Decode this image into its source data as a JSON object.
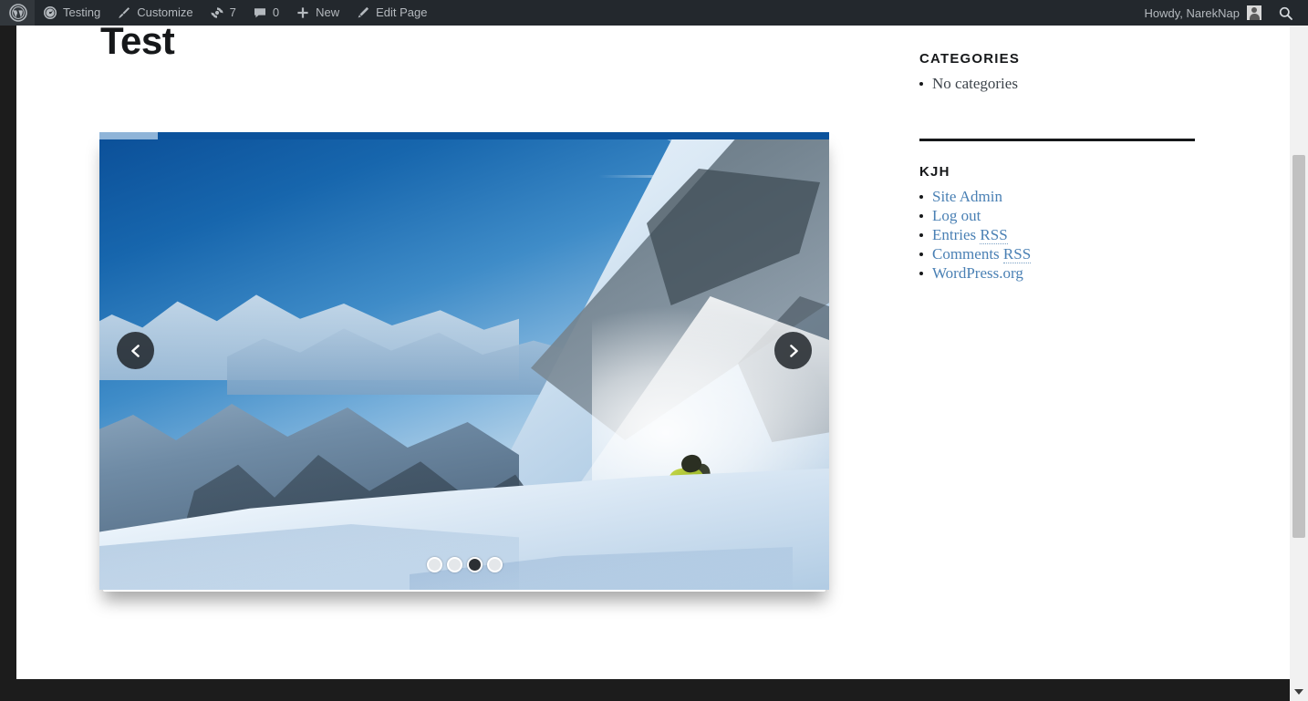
{
  "admin_bar": {
    "logo_icon": "wordpress-logo-icon",
    "items": [
      {
        "id": "site-name",
        "label": "Testing",
        "icon": "dashboard-speedometer-icon"
      },
      {
        "id": "customize",
        "label": "Customize",
        "icon": "paintbrush-icon"
      },
      {
        "id": "updates",
        "label": "7",
        "icon": "update-arrows-icon"
      },
      {
        "id": "comments",
        "label": "0",
        "icon": "comment-bubble-icon"
      },
      {
        "id": "new-content",
        "label": "New",
        "icon": "plus-icon"
      },
      {
        "id": "edit-page",
        "label": "Edit Page",
        "icon": "pencil-icon"
      }
    ],
    "howdy": "Howdy, NarekNap",
    "avatar_icon": "user-avatar-icon",
    "search_icon": "search-icon",
    "background_color": "#23282d",
    "text_color": "#b4b9be"
  },
  "page": {
    "title": "Test"
  },
  "slider": {
    "alt": "Skier carving through deep powder on a sunlit alpine slope",
    "progress_percent": 8,
    "prev_icon": "chevron-left-icon",
    "next_icon": "chevron-right-icon",
    "dots": [
      {
        "index": 1,
        "active": false
      },
      {
        "index": 2,
        "active": false
      },
      {
        "index": 3,
        "active": true
      },
      {
        "index": 4,
        "active": false
      }
    ]
  },
  "sidebar": {
    "widgets": [
      {
        "id": "categories",
        "title": "CATEGORIES",
        "items": [
          {
            "label": "No categories",
            "is_link": false
          }
        ]
      },
      {
        "id": "meta",
        "title": "KJH",
        "items": [
          {
            "label": "Site Admin",
            "is_link": true
          },
          {
            "label": "Log out",
            "is_link": true
          },
          {
            "label": "Entries RSS",
            "is_link": true,
            "abbr": "RSS"
          },
          {
            "label": "Comments RSS",
            "is_link": true,
            "abbr": "RSS"
          },
          {
            "label": "WordPress.org",
            "is_link": true
          }
        ]
      }
    ],
    "link_color": "#4a80b4"
  },
  "scrollbar": {
    "down_arrow_icon": "triangle-down-icon",
    "up_arrow_icon": "triangle-up-icon",
    "thumb_color": "#c1c1c1"
  }
}
